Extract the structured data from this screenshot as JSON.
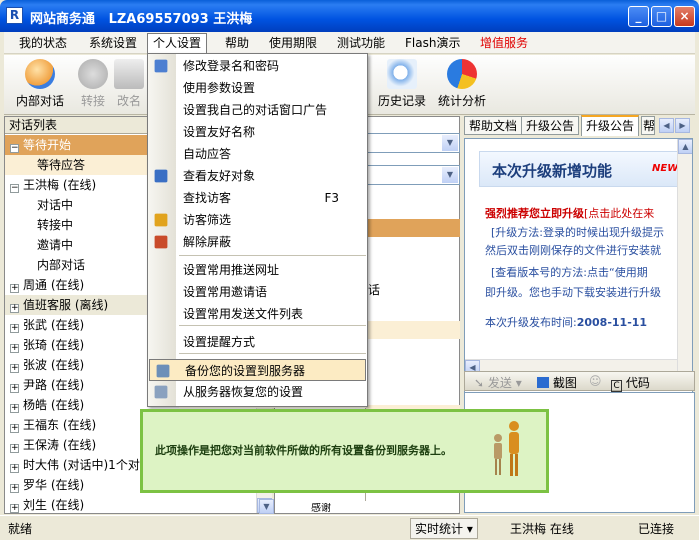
{
  "window": {
    "title": "网站商务通   LZA69557093 王洪梅",
    "app_icon": "R",
    "minimize": "_",
    "maximize": "□",
    "close": "×"
  },
  "menu": [
    "我的状态",
    "系统设置",
    "个人设置",
    "帮助",
    "使用期限",
    "测试功能",
    "Flash演示",
    "增值服务"
  ],
  "menu_highlight_color": "#e00000",
  "toolbar": {
    "items": [
      {
        "label": "内部对话",
        "icon": "users-icon"
      },
      {
        "label": "转接",
        "icon": "transfer-icon"
      },
      {
        "label": "改名",
        "icon": "rename-icon"
      },
      {
        "label": "历史记录",
        "icon": "history-icon"
      },
      {
        "label": "统计分析",
        "icon": "chart-icon"
      }
    ]
  },
  "left": {
    "header": "对话列表",
    "tree": [
      {
        "label": "等待开始",
        "expander": "−",
        "indent": 0,
        "style": "dark"
      },
      {
        "label": "等待应答",
        "indent": 1,
        "style": "light"
      },
      {
        "label": "王洪梅 (在线)",
        "expander": "−",
        "indent": 0
      },
      {
        "label": "对话中",
        "indent": 1
      },
      {
        "label": "转接中",
        "indent": 1
      },
      {
        "label": "邀请中",
        "indent": 1
      },
      {
        "label": "内部对话",
        "indent": 1
      },
      {
        "label": "周通 (在线)",
        "expander": "+",
        "indent": 0
      },
      {
        "label": "值班客服 (离线)",
        "expander": "+",
        "indent": 0,
        "style": "gray"
      },
      {
        "label": "张武 (在线)",
        "expander": "+",
        "indent": 0
      },
      {
        "label": "张琦 (在线)",
        "expander": "+",
        "indent": 0
      },
      {
        "label": "张波 (在线)",
        "expander": "+",
        "indent": 0
      },
      {
        "label": "尹路 (在线)",
        "expander": "+",
        "indent": 0
      },
      {
        "label": "杨皓 (在线)",
        "expander": "+",
        "indent": 0
      },
      {
        "label": "王福东 (在线)",
        "expander": "+",
        "indent": 0
      },
      {
        "label": "王保涛 (在线)",
        "expander": "+",
        "indent": 0
      },
      {
        "label": "时大伟 (对话中)1个对话",
        "expander": "+",
        "indent": 0
      },
      {
        "label": "罗华 (在线)",
        "expander": "+",
        "indent": 0
      },
      {
        "label": "刘生 (在线)",
        "expander": "+",
        "indent": 0
      }
    ]
  },
  "middle": {
    "partial_text_1": "话",
    "partial_text_2": "感谢"
  },
  "right": {
    "tabs": [
      "帮助文档",
      "升级公告",
      "升级公告",
      "帮"
    ],
    "notice": {
      "heading": "本次升级新增功能",
      "new_badge": "NEW",
      "line1": "强烈推荐您立即升级",
      "line1b": "[点击此处在来",
      "line2": "[升级方法:登录的时候出现升级提示",
      "line3": "然后双击刚刚保存的文件进行安装就",
      "line4": "[查看版本号的方法:点击“使用期",
      "line5": "即升级。您也手动下载安装进行升级",
      "date_label": "本次升级发布时间:",
      "date_value": "2008-11-11"
    },
    "chatbar": {
      "send": "发送",
      "screenshot": "截图",
      "code": "代码"
    }
  },
  "dropdown": {
    "items": [
      {
        "label": "修改登录名和密码",
        "icon": "id-card-icon"
      },
      {
        "label": "使用参数设置"
      },
      {
        "label": "设置我自己的对话窗口广告"
      },
      {
        "label": "设置友好名称"
      },
      {
        "label": "自动应答"
      },
      {
        "label": "查看友好对象",
        "icon": "contacts-icon"
      },
      {
        "label": "查找访客",
        "shortcut": "F3"
      },
      {
        "label": "访客筛选",
        "icon": "filter-icon"
      },
      {
        "label": "解除屏蔽",
        "icon": "unblock-icon"
      },
      {
        "label": "设置常用推送网址"
      },
      {
        "label": "设置常用邀请语"
      },
      {
        "label": "设置常用发送文件列表"
      },
      {
        "label": "设置提醒方式"
      },
      {
        "label": "备份您的设置到服务器",
        "icon": "backup-icon",
        "selected": true
      },
      {
        "label": "从服务器恢复您的设置",
        "icon": "restore-icon"
      }
    ]
  },
  "tooltip": {
    "text": "此项操作是把您对当前软件所做的所有设置备份到服务器上。"
  },
  "status": {
    "left": "就绪",
    "stats": "实时统计",
    "user": "王洪梅 在线",
    "conn": "已连接"
  }
}
